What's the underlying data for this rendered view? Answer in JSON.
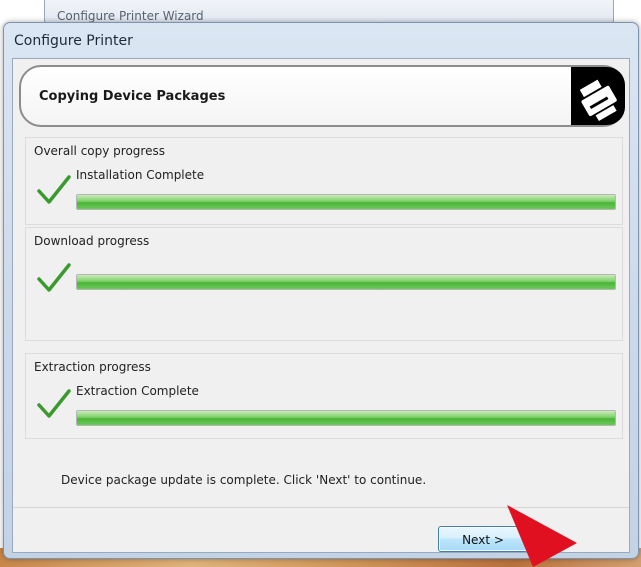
{
  "background_window": {
    "title": "Configure Printer Wizard"
  },
  "dialog": {
    "title": "Configure Printer",
    "header": {
      "title": "Copying Device Packages",
      "icon": "printer-icon"
    },
    "groups": [
      {
        "label": "Overall copy progress",
        "status": "Installation Complete",
        "progress": 100,
        "icon": "checkmark-icon"
      },
      {
        "label": "Download progress",
        "status": "",
        "progress": 100,
        "icon": "checkmark-icon"
      },
      {
        "label": "Extraction progress",
        "status": "Extraction Complete",
        "progress": 100,
        "icon": "checkmark-icon"
      }
    ],
    "message": "Device package update is complete.  Click 'Next' to continue.",
    "next_label": "Next >"
  },
  "colors": {
    "progress_fill": "#4bb437",
    "checkmark": "#3a9a2e",
    "button_border": "#3c7fb1",
    "arrow": "#e01020"
  }
}
